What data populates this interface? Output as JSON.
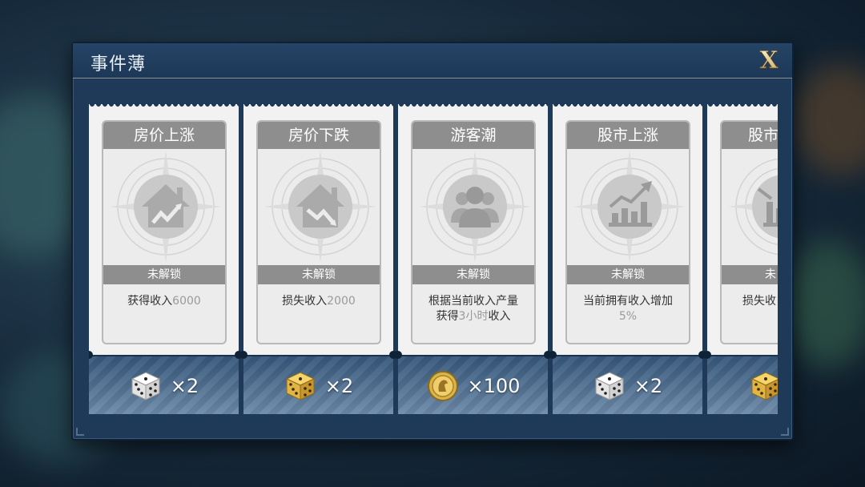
{
  "dialog": {
    "title": "事件薄",
    "close_label": "X"
  },
  "cards": [
    {
      "title": "房价上涨",
      "icon": "house-up-icon",
      "lock_label": "未解锁",
      "desc_prefix": "获得收入",
      "desc_value": "6000",
      "desc_line2_prefix": "",
      "desc_line2_value": "",
      "desc_line2_suffix": "",
      "reward_icon": "white-dice-icon",
      "reward_amount": "×2"
    },
    {
      "title": "房价下跌",
      "icon": "house-down-icon",
      "lock_label": "未解锁",
      "desc_prefix": "损失收入",
      "desc_value": "2000",
      "desc_line2_prefix": "",
      "desc_line2_value": "",
      "desc_line2_suffix": "",
      "reward_icon": "gold-dice-icon",
      "reward_amount": "×2"
    },
    {
      "title": "游客潮",
      "icon": "people-group-icon",
      "lock_label": "未解锁",
      "desc_prefix": "根据当前收入产量",
      "desc_value": "",
      "desc_line2_prefix": "获得",
      "desc_line2_value": "3小时",
      "desc_line2_suffix": "收入",
      "reward_icon": "gold-coin-icon",
      "reward_amount": "×100"
    },
    {
      "title": "股市上涨",
      "icon": "stock-up-icon",
      "lock_label": "未解锁",
      "desc_prefix": "当前拥有收入增加",
      "desc_value": "",
      "desc_line2_prefix": "",
      "desc_line2_value": "5%",
      "desc_line2_suffix": "",
      "reward_icon": "white-dice-icon",
      "reward_amount": "×2"
    },
    {
      "title": "股市",
      "icon": "stock-down-icon",
      "lock_label": "未",
      "desc_prefix": "损失收",
      "desc_value": "",
      "desc_line2_prefix": "",
      "desc_line2_value": "",
      "desc_line2_suffix": "",
      "reward_icon": "gold-dice-icon",
      "reward_amount": ""
    }
  ],
  "colors": {
    "panel": "#1f3a59",
    "card_header": "#8e8e8e",
    "highlight_value": "#9a9a9a",
    "gold": "#d9b44a"
  }
}
